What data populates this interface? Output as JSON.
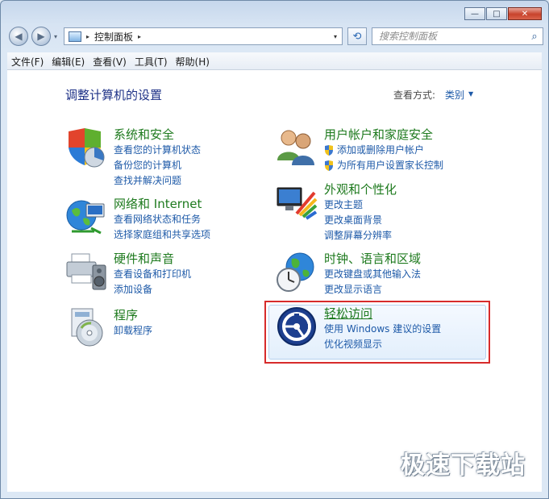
{
  "window": {
    "minimize_glyph": "—",
    "maximize_glyph": "□",
    "close_glyph": "✕"
  },
  "nav": {
    "back_glyph": "◀",
    "forward_glyph": "▶",
    "dropdown_glyph": "▾",
    "address_sep": "▸",
    "address_crumb": "控制面板",
    "address_dropdown": "▾",
    "refresh_glyph": "⟲",
    "search_placeholder": "搜索控制面板",
    "search_icon": "⌕"
  },
  "menubar": [
    "文件(F)",
    "编辑(E)",
    "查看(V)",
    "工具(T)",
    "帮助(H)"
  ],
  "main": {
    "title": "调整计算机的设置",
    "view_by_label": "查看方式:",
    "view_by_value": "类别",
    "view_by_caret": "▼"
  },
  "categories": {
    "system": {
      "title": "系统和安全",
      "links": [
        "查看您的计算机状态",
        "备份您的计算机",
        "查找并解决问题"
      ],
      "icon": "shield-chart-icon"
    },
    "network": {
      "title": "网络和 Internet",
      "links": [
        "查看网络状态和任务",
        "选择家庭组和共享选项"
      ],
      "icon": "globe-network-icon"
    },
    "hardware": {
      "title": "硬件和声音",
      "links": [
        "查看设备和打印机",
        "添加设备"
      ],
      "icon": "printer-speaker-icon"
    },
    "programs": {
      "title": "程序",
      "links": [
        "卸载程序"
      ],
      "icon": "program-disc-icon"
    },
    "users": {
      "title": "用户帐户和家庭安全",
      "links": [
        "添加或删除用户帐户",
        "为所有用户设置家长控制"
      ],
      "icon": "users-icon"
    },
    "appearance": {
      "title": "外观和个性化",
      "links": [
        "更改主题",
        "更改桌面背景",
        "调整屏幕分辨率"
      ],
      "icon": "monitor-palette-icon"
    },
    "clock": {
      "title": "时钟、语言和区域",
      "links": [
        "更改键盘或其他输入法",
        "更改显示语言"
      ],
      "icon": "globe-clock-icon"
    },
    "ease": {
      "title": "轻松访问",
      "links": [
        "使用 Windows 建议的设置",
        "优化视频显示"
      ],
      "icon": "ease-of-access-icon"
    }
  },
  "watermark": "极速下载站",
  "colors": {
    "category_title": "#1e7a1e",
    "link": "#1e5aa8",
    "highlight_border": "#d72b2b",
    "page_title": "#1e3287"
  }
}
